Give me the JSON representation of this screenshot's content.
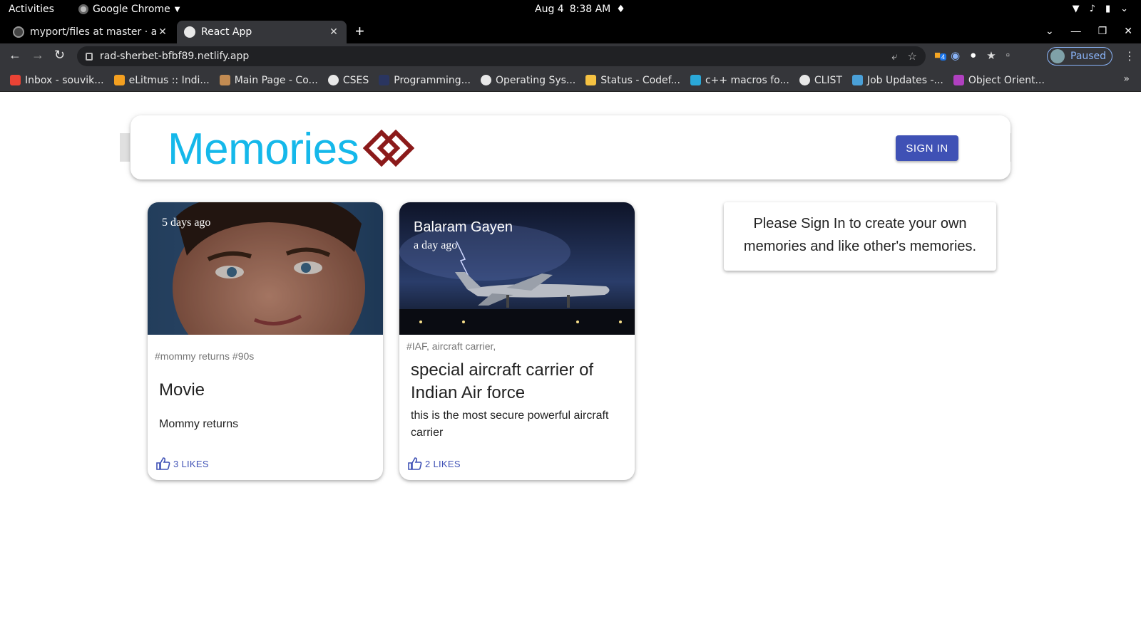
{
  "system_bar": {
    "activities": "Activities",
    "app_name": "Google Chrome",
    "date": "Aug 4",
    "time": "8:38 AM"
  },
  "browser": {
    "tabs": [
      {
        "label": "myport/files at master · a",
        "active": false
      },
      {
        "label": "React App",
        "active": true
      }
    ],
    "url": "rad-sherbet-bfbf89.netlify.app",
    "profile_label": "Paused",
    "extension_badge": "4",
    "bookmarks": [
      {
        "label": "Inbox - souvik...",
        "icon": "gmail-icon",
        "color": "#ea4335"
      },
      {
        "label": "eLitmus :: Indi...",
        "icon": "elitmus-icon",
        "color": "#f4a020"
      },
      {
        "label": "Main Page - Co...",
        "icon": "cp-algorithms-icon",
        "color": "#c28b52"
      },
      {
        "label": "CSES",
        "icon": "globe-icon",
        "color": "#e8e8e8"
      },
      {
        "label": "Programming...",
        "icon": "programming-icon",
        "color": "#2a3560"
      },
      {
        "label": "Operating Sys...",
        "icon": "globe-icon",
        "color": "#e8e8e8"
      },
      {
        "label": "Status - Codef...",
        "icon": "codeforces-icon",
        "color": "#f5c242"
      },
      {
        "label": "c++ macros fo...",
        "icon": "cpp-icon",
        "color": "#2aa8d8"
      },
      {
        "label": "CLIST",
        "icon": "globe-icon",
        "color": "#e8e8e8"
      },
      {
        "label": "Job Updates -...",
        "icon": "job-updates-icon",
        "color": "#4aa0d8"
      },
      {
        "label": "Object Orient...",
        "icon": "oop-icon",
        "color": "#b040c0"
      }
    ]
  },
  "app": {
    "brand": "Memories",
    "sign_in": "SIGN IN",
    "posts": [
      {
        "creator": "",
        "time_ago": "5 days ago",
        "tags": "#mommy returns #90s",
        "title": "Movie",
        "message": "Mommy returns",
        "likes": "3 LIKES",
        "image": "portrait-photo"
      },
      {
        "creator": "Balaram Gayen",
        "time_ago": "a day ago",
        "tags": "#IAF, aircraft carrier,",
        "title": "special aircraft carrier of Indian Air force",
        "message": "this is the most secure powerful aircraft carrier",
        "likes": "2 LIKES",
        "image": "aircraft-night-photo"
      }
    ],
    "signin_notice": "Please Sign In to create your own memories and like other's memories."
  },
  "colors": {
    "brand": "#15b8ea",
    "primary": "#3f51b5",
    "logo": "#8b1a1a"
  }
}
